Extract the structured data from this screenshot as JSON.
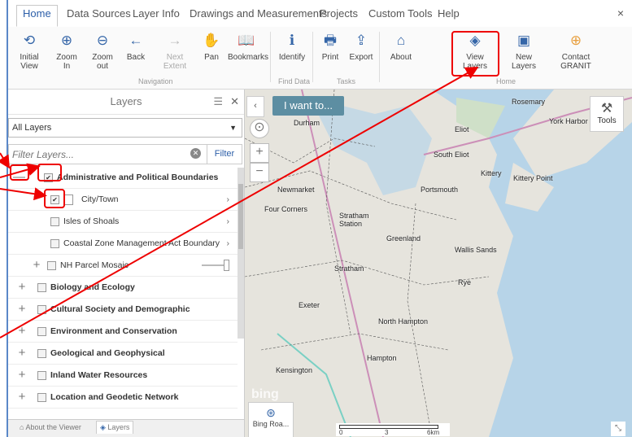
{
  "ribbon": {
    "tabs": [
      "Home",
      "Data Sources",
      "Layer Info",
      "Drawings and Measurements",
      "Projects",
      "Custom Tools",
      "Help"
    ],
    "close": "×"
  },
  "toolbar": {
    "initial_view": "Initial View",
    "zoom_in": "Zoom In",
    "zoom_out": "Zoom out",
    "back": "Back",
    "next_extent": "Next Extent",
    "pan": "Pan",
    "bookmarks": "Bookmarks",
    "identify": "Identify",
    "print": "Print",
    "export": "Export",
    "about": "About",
    "view_layers": "View Layers",
    "new_layers": "New Layers",
    "contact": "Contact GRANIT",
    "groups": {
      "navigation": "Navigation",
      "find_data": "Find Data",
      "tasks": "Tasks",
      "home": "Home"
    }
  },
  "panel": {
    "title": "Layers",
    "select_value": "All Layers",
    "filter_placeholder": "Filter Layers...",
    "filter_button": "Filter",
    "rows": [
      {
        "label": "Administrative and Political Boundaries",
        "checked": true
      },
      {
        "label": "City/Town",
        "checked": true
      },
      {
        "label": "Isles of Shoals"
      },
      {
        "label": "Coastal Zone Management Act Boundary"
      },
      {
        "label": "NH Parcel Mosaic"
      },
      {
        "label": "Biology and Ecology"
      },
      {
        "label": "Cultural Society and Demographic"
      },
      {
        "label": "Environment and Conservation"
      },
      {
        "label": "Geological and Geophysical"
      },
      {
        "label": "Inland Water Resources"
      },
      {
        "label": "Location and Geodetic Network"
      }
    ],
    "bottom_tabs": [
      "About the Viewer",
      "Layers"
    ]
  },
  "map": {
    "i_want_to": "I want to...",
    "tools": "Tools",
    "basemap": "Bing Roa...",
    "scale_labels": [
      "0",
      "3",
      "6km"
    ],
    "bing": "bing",
    "towns": [
      "Rosemary",
      "Durham",
      "Eliot",
      "York Harbor",
      "South Eliot",
      "Kittery",
      "Kittery Point",
      "Newmarket",
      "Portsmouth",
      "Four Corners",
      "Stratham Station",
      "Greenland",
      "Wallis Sands",
      "Stratham",
      "Rye",
      "Exeter",
      "North Hampton",
      "Kensington",
      "Hampton"
    ]
  },
  "colors": {
    "accent": "#2b5ea8",
    "highlight": "#e00000"
  }
}
